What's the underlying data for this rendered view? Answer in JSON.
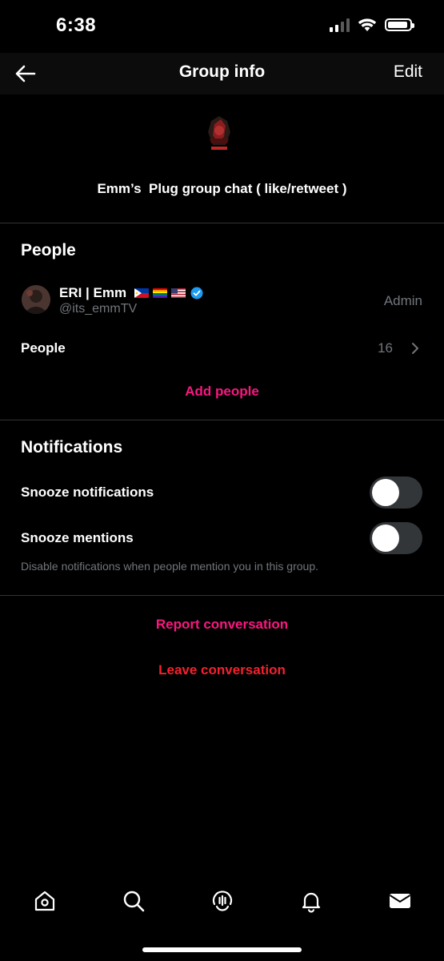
{
  "status_bar": {
    "time": "6:38"
  },
  "nav": {
    "title": "Group info",
    "edit_label": "Edit"
  },
  "group": {
    "name": "Emm’s  Plug group chat ( like/retweet )"
  },
  "people": {
    "section_title": "People",
    "members": [
      {
        "name": "ERI | Emm",
        "handle": "@its_emmTV",
        "role": "Admin",
        "verified": true
      }
    ],
    "people_row_label": "People",
    "count": "16",
    "add_people_label": "Add people"
  },
  "notifications": {
    "section_title": "Notifications",
    "snooze_notifications_label": "Snooze notifications",
    "snooze_notifications_on": false,
    "snooze_mentions_label": "Snooze mentions",
    "snooze_mentions_on": false,
    "hint": "Disable notifications when people mention you in this group."
  },
  "actions": {
    "report_label": "Report conversation",
    "leave_label": "Leave conversation"
  },
  "tabs": [
    "home-icon",
    "search-icon",
    "spaces-icon",
    "notifications-icon",
    "messages-icon"
  ],
  "colors": {
    "accent_pink": "#f91880",
    "danger_red": "#f4212e",
    "muted": "#71767b",
    "verified": "#1d9bf0"
  }
}
